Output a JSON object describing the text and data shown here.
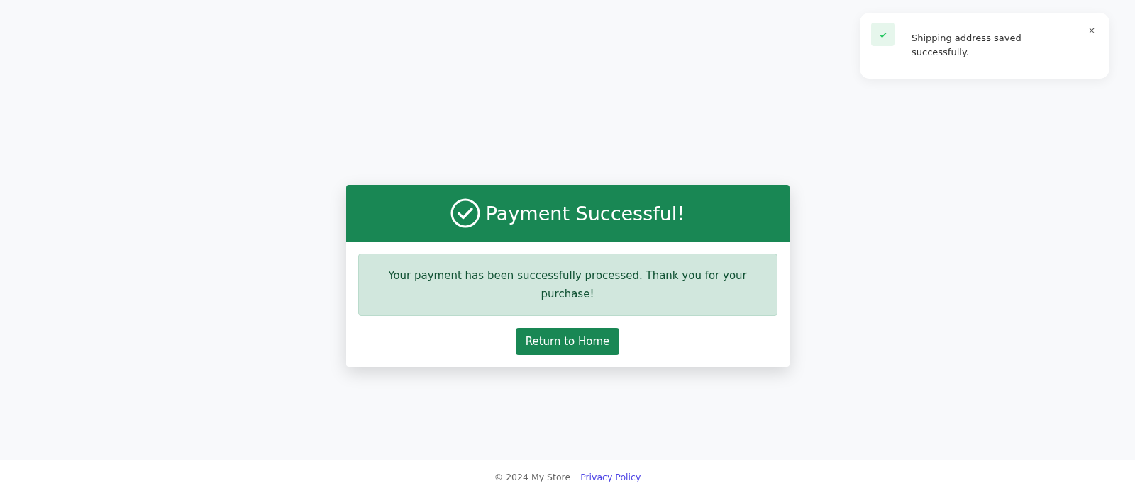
{
  "toast": {
    "message": "Shipping address saved successfully.",
    "close": "×"
  },
  "card": {
    "title": "Payment Successful!",
    "alert": "Your payment has been successfully processed. Thank you for your purchase!",
    "button": "Return to Home"
  },
  "footer": {
    "copyright": "© 2024 My Store",
    "link": "Privacy Policy"
  }
}
